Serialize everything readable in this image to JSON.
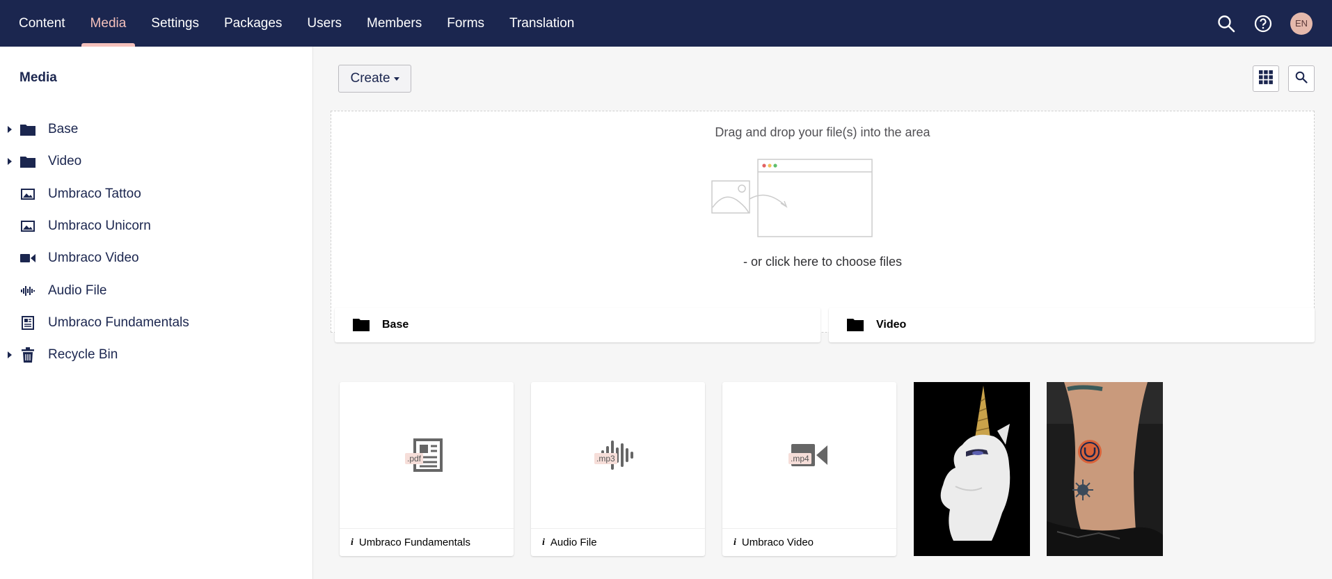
{
  "nav": {
    "items": [
      {
        "label": "Content"
      },
      {
        "label": "Media"
      },
      {
        "label": "Settings"
      },
      {
        "label": "Packages"
      },
      {
        "label": "Users"
      },
      {
        "label": "Members"
      },
      {
        "label": "Forms"
      },
      {
        "label": "Translation"
      }
    ],
    "active": "Media",
    "avatar_initials": "EN"
  },
  "sidebar": {
    "title": "Media",
    "items": [
      {
        "label": "Base",
        "icon": "folder-icon",
        "expandable": true
      },
      {
        "label": "Video",
        "icon": "folder-icon",
        "expandable": true
      },
      {
        "label": "Umbraco Tattoo",
        "icon": "image-icon",
        "expandable": false
      },
      {
        "label": "Umbraco Unicorn",
        "icon": "image-icon",
        "expandable": false
      },
      {
        "label": "Umbraco Video",
        "icon": "video-icon",
        "expandable": false
      },
      {
        "label": "Audio File",
        "icon": "audio-icon",
        "expandable": false
      },
      {
        "label": "Umbraco Fundamentals",
        "icon": "document-icon",
        "expandable": false
      },
      {
        "label": "Recycle Bin",
        "icon": "trash-icon",
        "expandable": true
      }
    ]
  },
  "toolbar": {
    "create_label": "Create"
  },
  "dropzone": {
    "title": "Drag and drop your file(s) into the area",
    "choose_label": "- or click here to choose files"
  },
  "folders": [
    {
      "label": "Base"
    },
    {
      "label": "Video"
    }
  ],
  "media_items": [
    {
      "label": "Umbraco Fundamentals",
      "ext": ".pdf",
      "icon": "document-icon"
    },
    {
      "label": "Audio File",
      "ext": ".mp3",
      "icon": "audio-icon"
    },
    {
      "label": "Umbraco Video",
      "ext": ".mp4",
      "icon": "video-icon"
    }
  ],
  "image_items": [
    {
      "name": "Umbraco Unicorn"
    },
    {
      "name": "Umbraco Tattoo"
    }
  ],
  "colors": {
    "header_bg": "#1b264f",
    "accent": "#f5c1bc",
    "text": "#1b264f"
  }
}
